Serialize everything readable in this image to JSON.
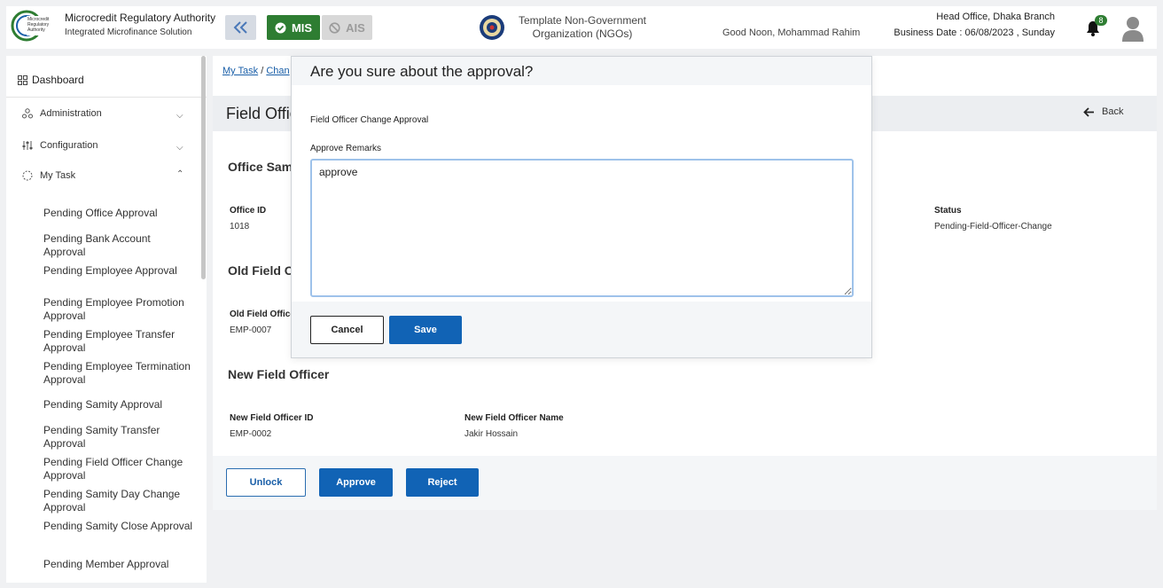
{
  "header": {
    "brand_title": "Microcredit Regulatory Authority",
    "brand_subtitle": "Integrated Microfinance Solution",
    "logo_text": "Microcredit Regulatory Authority",
    "mis_label": "MIS",
    "ais_label": "AIS",
    "org_name": "Template Non-Government Organization (NGOs)",
    "greeting": "Good Noon, Mohammad Rahim",
    "branch": "Head Office, Dhaka Branch",
    "business_date": "Business Date : 06/08/2023 , Sunday",
    "notification_count": "8",
    "colors": {
      "mis_green": "#2e7d32",
      "primary_blue": "#1163b5"
    }
  },
  "sidebar": {
    "dashboard": "Dashboard",
    "groups": [
      {
        "label": "Administration",
        "icon": "admin-icon",
        "expanded": false
      },
      {
        "label": "Configuration",
        "icon": "config-icon",
        "expanded": false
      },
      {
        "label": "My Task",
        "icon": "task-icon",
        "expanded": true
      }
    ],
    "items": [
      "Pending Office Approval",
      "Pending Bank Account Approval",
      "Pending Employee Approval",
      "Pending Employee Promotion Approval",
      "Pending Employee Transfer Approval",
      "Pending Employee Termination Approval",
      "Pending Samity Approval",
      "Pending Samity Transfer Approval",
      "Pending Field Officer Change Approval",
      "Pending Samity Day Change Approval",
      "Pending Samity Close Approval",
      "Pending Member Approval"
    ]
  },
  "breadcrumb": {
    "first": "My Task",
    "separator": "/",
    "second": "Chan"
  },
  "page": {
    "title": "Field Offic",
    "back_label": "Back",
    "office_section": "Office Sam",
    "office_id_label": "Office ID",
    "office_id_value": "1018",
    "status_label": "Status",
    "status_value": "Pending-Field-Officer-Change",
    "old_section": "Old Field O",
    "old_id_label": "Old Field Office",
    "old_id_value": "EMP-0007",
    "new_section": "New Field Officer",
    "new_id_label": "New Field Officer ID",
    "new_id_value": "EMP-0002",
    "new_name_label": "New Field Officer Name",
    "new_name_value": "Jakir Hossain",
    "buttons": {
      "unlock": "Unlock",
      "approve": "Approve",
      "reject": "Reject"
    }
  },
  "modal": {
    "title": "Are you sure about the approval?",
    "subtitle": "Field Officer Change Approval",
    "remarks_label": "Approve Remarks",
    "remarks_value": "approve",
    "cancel": "Cancel",
    "save": "Save"
  }
}
